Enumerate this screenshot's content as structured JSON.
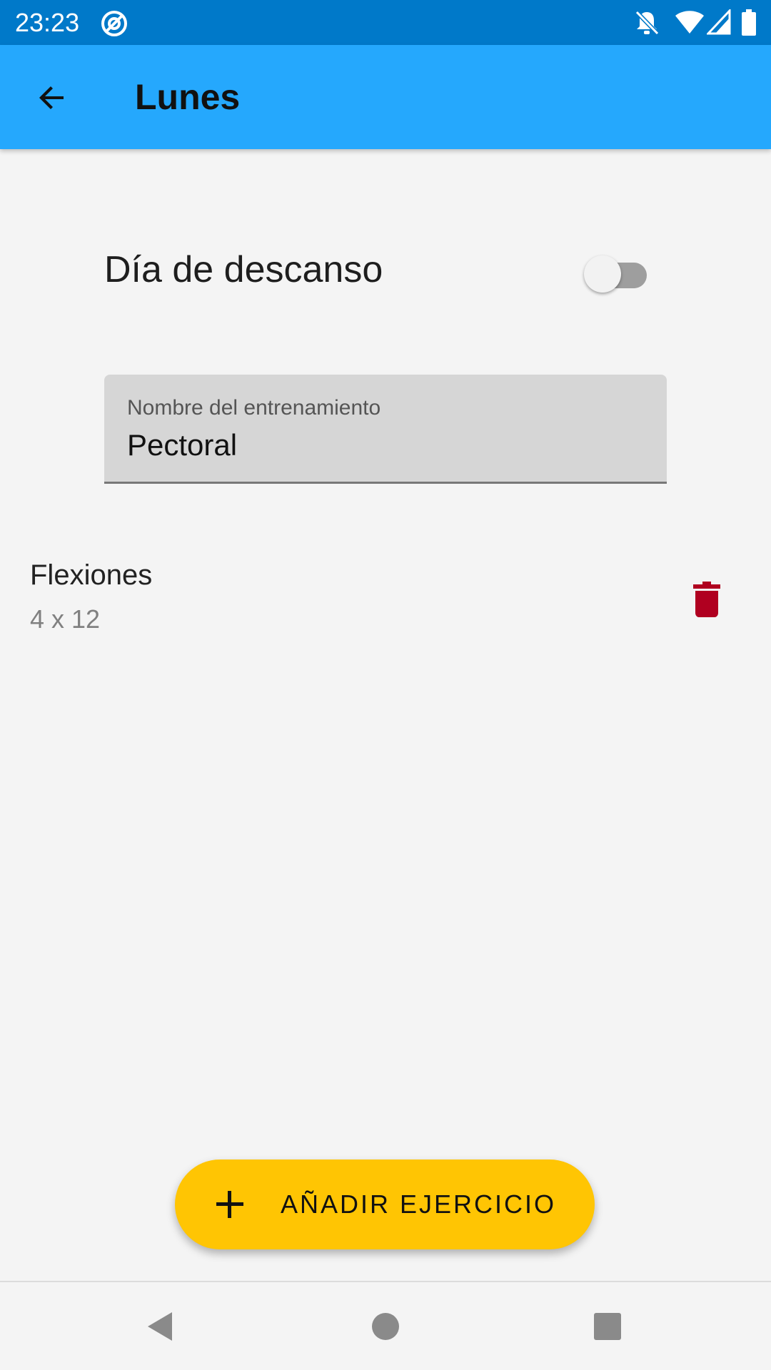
{
  "status_bar": {
    "time": "23:23",
    "icons": [
      "at-sign-icon",
      "notifications-off-icon",
      "wifi-icon",
      "signal-icon",
      "battery-icon"
    ]
  },
  "app_bar": {
    "title": "Lunes",
    "back_icon": "arrow-back-icon",
    "color": "#25a8fd"
  },
  "rest_day": {
    "label": "Día de descanso",
    "enabled": false
  },
  "workout_name": {
    "label": "Nombre del entrenamiento",
    "value": "Pectoral"
  },
  "exercises": [
    {
      "name": "Flexiones",
      "detail": "4 x 12",
      "delete_icon": "trash-icon",
      "delete_color": "#b00020"
    }
  ],
  "fab": {
    "label": "AÑADIR EJERCICIO",
    "icon": "plus-icon",
    "color": "#ffc503"
  },
  "nav_bar": {
    "buttons": [
      "back-triangle-icon",
      "home-circle-icon",
      "recents-square-icon"
    ]
  }
}
